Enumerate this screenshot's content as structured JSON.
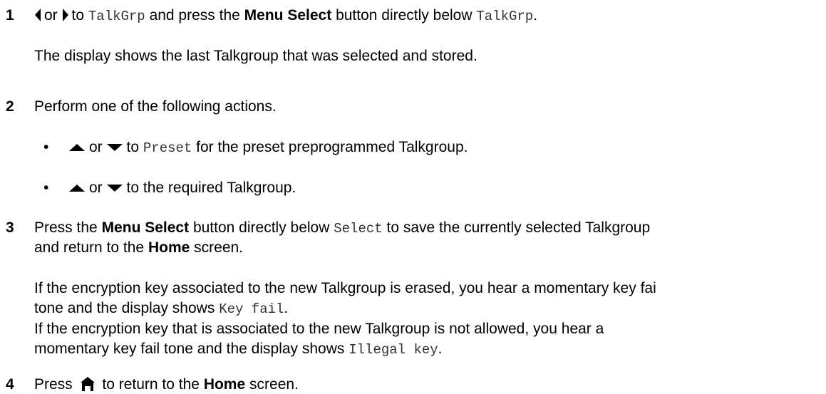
{
  "step1": {
    "number": "1",
    "or": "or",
    "to": "to",
    "menu_item": "TalkGrp",
    "text_a": "and press the",
    "button_name": "Menu Select",
    "text_b": "button directly below",
    "menu_item_2": "TalkGrp",
    "period": ".",
    "note": "The display shows the last Talkgroup that was selected and stored."
  },
  "step2": {
    "number": "2",
    "text": "Perform one of the following actions.",
    "bullets": [
      {
        "or": "or",
        "to": "to",
        "code": "Preset",
        "rest": "for the preset preprogrammed Talkgroup."
      },
      {
        "or": "or",
        "rest": "to the required Talkgroup."
      }
    ]
  },
  "step3": {
    "number": "3",
    "press": "Press the",
    "button_name": "Menu Select",
    "text_a": "button directly below",
    "code": "Select",
    "text_b": "to save the currently selected Talkgroup",
    "line2_a": "and return to the",
    "home": "Home",
    "line2_b": "screen.",
    "note1_line1": "If the encryption key associated to the new Talkgroup is erased, you hear a momentary key fai",
    "note1_line2": "tone and the display shows",
    "note1_code": "Key fail",
    "note1_period": ".",
    "note2_line1": "If the encryption key that is associated to the new Talkgroup is not allowed, you hear a",
    "note2_line2": "momentary key fail tone and the display shows",
    "note2_code": "Illegal key",
    "note2_period": "."
  },
  "step4": {
    "number": "4",
    "press": "Press",
    "text_a": "to return to the",
    "home": "Home",
    "text_b": "screen."
  },
  "icons": {
    "left": "nav-left-icon",
    "right": "nav-right-icon",
    "up": "nav-up-icon",
    "down": "nav-down-icon",
    "home": "home-icon"
  }
}
